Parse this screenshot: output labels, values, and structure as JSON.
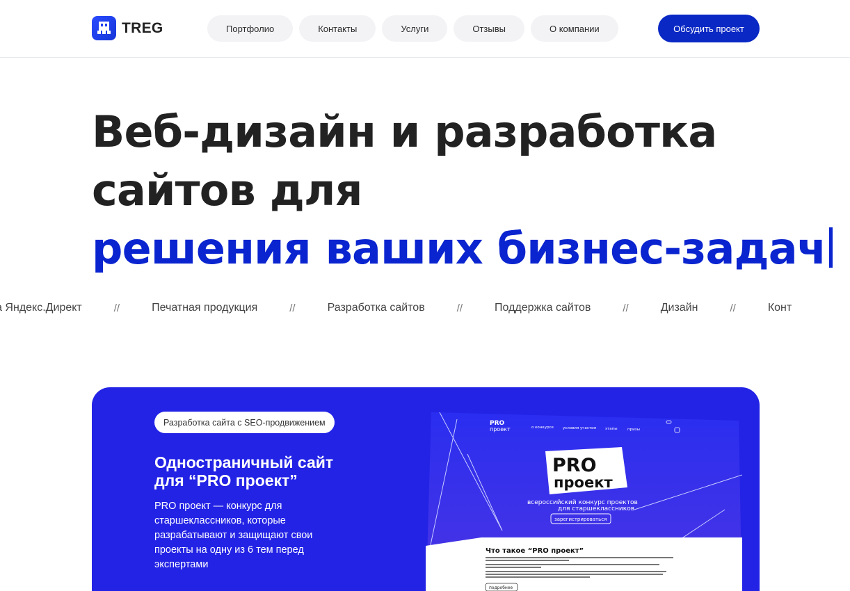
{
  "header": {
    "logo_text": "TREG",
    "nav": [
      "Портфолио",
      "Контакты",
      "Услуги",
      "Отзывы",
      "О компании"
    ],
    "cta": "Обсудить проект"
  },
  "hero": {
    "line1": "Веб-дизайн и разработка",
    "line2": "сайтов для",
    "line3": "решения ваших бизнес-задач"
  },
  "ticker": {
    "items": [
      "ройка Яндекс.Директ",
      "Печатная продукция",
      "Разработка сайтов",
      "Поддержка сайтов",
      "Дизайн",
      "Конт"
    ],
    "separator": "//"
  },
  "card": {
    "tag": "Разработка сайта с SEO-продвижением",
    "title_line1": "Одностраничный сайт",
    "title_line2": "для “PRO проект”",
    "description": "PRO проект — конкурс для старшеклассников, которые разрабатывают и защищают свои проекты на одну из 6 тем перед экспертами",
    "mockup": {
      "logo_line1": "PRO",
      "logo_line2": "проект",
      "nav": [
        "о конкурсе",
        "условия участия",
        "этапы",
        "призы"
      ],
      "big_line1": "PRO",
      "big_line2": "проект",
      "subtitle_line1": "всероссийский конкурс проектов",
      "subtitle_line2": "для старшеклассников",
      "register": "зарегистрироваться",
      "section_title": "Что такое “PRO проект”",
      "more": "подробнее"
    }
  },
  "colors": {
    "accent": "#0a24cf",
    "card_bg": "#2323e6",
    "cta_bg": "#0a28c4"
  }
}
